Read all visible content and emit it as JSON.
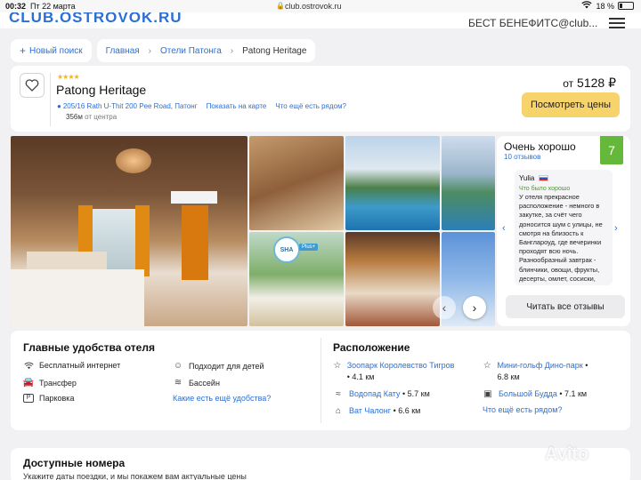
{
  "status_bar": {
    "time": "00:32",
    "date": "Пт 22 марта",
    "url": "club.ostrovok.ru",
    "wifi_icon": "wifi-icon",
    "battery": "18 %"
  },
  "header": {
    "logo": "CLUB.OSTROVOK.RU",
    "benefit": "БЕСТ БЕНЕФИТС@club..."
  },
  "breadcrumbs": {
    "new_search": "Новый поиск",
    "home": "Главная",
    "hotels": "Отели Патонга",
    "current": "Patong Heritage"
  },
  "hotel": {
    "stars": "★★★★",
    "name": "Patong Heritage",
    "address": "205/16 Rath U-Thit 200 Pee Road, Патонг",
    "show_on_map": "Показать на карте",
    "nearby": "Что ещё есть рядом?",
    "distance_value": "356м",
    "distance_label": "от центра",
    "price_prefix": "от",
    "price": "5128 ₽",
    "show_prices": "Посмотреть цены"
  },
  "gallery": {
    "badge": "SHA",
    "badge_plus": "Plus+"
  },
  "reviews": {
    "title": "Очень хорошо",
    "count": "10 отзывов",
    "score": "7",
    "review": {
      "author": "Yulia",
      "good_label": "Что было хорошо",
      "text": "У отеля прекрасное расположение - немного в закутке, за счёт чего доносится шум с улицы, не смотря на близость к Банглароуд, где вечеринки проходят всю ночь. Разнообразный завтрак - блинчики, овощи, фрукты, десерты, омлет, сосиски,"
    },
    "read_all": "Читать все отзывы"
  },
  "amenities": {
    "title": "Главные удобства отеля",
    "items": [
      {
        "label": "Бесплатный интернет",
        "icon": "wifi-icon"
      },
      {
        "label": "Трансфер",
        "icon": "car-icon"
      },
      {
        "label": "Парковка",
        "icon": "parking-icon"
      },
      {
        "label": "Подходит для детей",
        "icon": "child-icon"
      },
      {
        "label": "Бассейн",
        "icon": "pool-icon"
      }
    ],
    "more": "Какие есть ещё удобства?"
  },
  "location": {
    "title": "Расположение",
    "places": [
      {
        "name": "Зоопарк Королевство Тигров",
        "distance": "4.1 км",
        "icon": "star-icon"
      },
      {
        "name": "Водопад Кату",
        "distance": "5.7 км",
        "icon": "waterfall-icon"
      },
      {
        "name": "Ват Чалонг",
        "distance": "6.6 км",
        "icon": "temple-icon"
      },
      {
        "name": "Мини-гольф Дино-парк",
        "distance": "6.8 км",
        "icon": "star-icon"
      },
      {
        "name": "Большой Будда",
        "distance": "7.1 км",
        "icon": "monument-icon"
      }
    ],
    "more": "Что ещё есть рядом?"
  },
  "rooms": {
    "title": "Доступные номера",
    "subtitle": "Укажите даты поездки, и мы покажем вам актуальные цены"
  },
  "watermark": "Avito"
}
